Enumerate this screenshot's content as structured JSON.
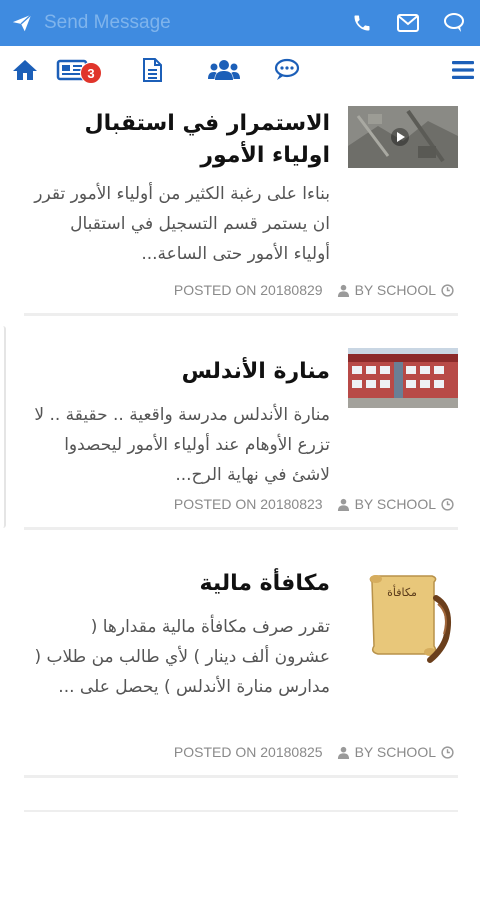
{
  "topbar": {
    "message_placeholder": "Send Message",
    "accent_color": "#3f8be0",
    "icons": [
      "send-icon",
      "phone-icon",
      "mail-icon",
      "chat-icon"
    ]
  },
  "nav": {
    "icon_color": "#1c5fb8",
    "items": [
      {
        "name": "home-icon"
      },
      {
        "name": "news-icon",
        "badge": "3"
      },
      {
        "name": "document-icon"
      },
      {
        "name": "users-icon"
      },
      {
        "name": "comments-icon"
      },
      {
        "name": "menu-icon"
      }
    ]
  },
  "posts": [
    {
      "title": "الاستمرار في استقبال اولياء الأمور",
      "excerpt": "بناءا على رغبة الكثير من أولياء الأمور تقرر ان يستمر قسم التسجيل في استقبال أولياء الأمور حتى الساعة...",
      "date": "POSTED ON 20180829",
      "author": "BY SCHOOL",
      "thumb": "video-thumbnail"
    },
    {
      "title": "منارة الأندلس",
      "excerpt": "منارة الأندلس مدرسة واقعية .. حقيقة .. لا تزرع الأوهام عند أولياء الأمور ليحصدوا لاشئ في نهاية الرح...",
      "date": "POSTED ON 20180823",
      "author": "BY SCHOOL",
      "thumb": "school-building-photo"
    },
    {
      "title": "مكافأة مالية",
      "excerpt": "تقرر صرف مكافأة مالية مقدارها ( عشرون ألف دينار ) لأي طالب من طلاب ( مدارس منارة الأندلس ) يحصل على ...",
      "date": "POSTED ON 20180825",
      "author": "BY SCHOOL",
      "thumb": "scroll-quill-image",
      "thumb_text": "مكافأة"
    }
  ]
}
